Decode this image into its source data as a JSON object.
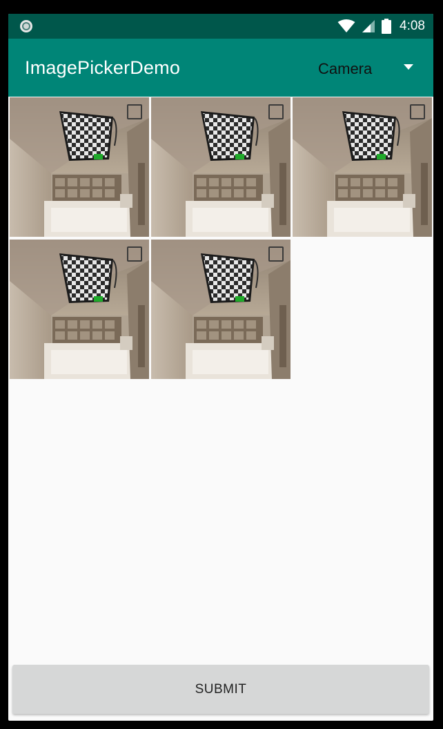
{
  "status_bar": {
    "time": "4:08",
    "icons": [
      "notification-circle-icon",
      "wifi-icon",
      "cell-signal-icon",
      "battery-icon"
    ]
  },
  "app_bar": {
    "title": "ImagePickerDemo",
    "source_selector": {
      "selected": "Camera",
      "icon": "dropdown-arrow-icon"
    }
  },
  "images": [
    {
      "checked": false
    },
    {
      "checked": false
    },
    {
      "checked": false
    },
    {
      "checked": false
    },
    {
      "checked": false
    }
  ],
  "submit_label": "SUBMIT",
  "colors": {
    "status_bar": "#00574b",
    "app_bar": "#008577",
    "background": "#fafafa",
    "button": "#d6d7d7"
  }
}
